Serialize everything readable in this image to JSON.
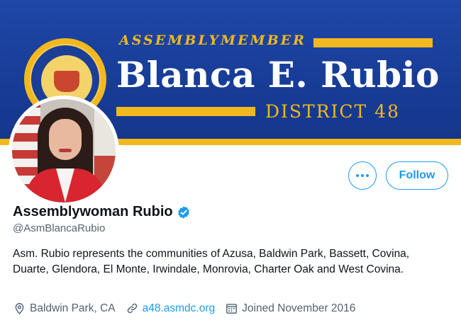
{
  "banner": {
    "kicker": "ASSEMBLYMEMBER",
    "name": "Blanca E. Rubio",
    "district": "DISTRICT 48",
    "colors": {
      "blue": "#1f47a8",
      "gold": "#f2b81e"
    }
  },
  "profile": {
    "display_name": "Assemblywoman Rubio",
    "verified_icon": "verified-badge-icon",
    "handle": "@AsmBlancaRubio",
    "bio": "Asm. Rubio represents the communities of Azusa, Baldwin Park, Bassett, Covina, Duarte, Glendora, El Monte, Irwindale, Monrovia, Charter Oak and West Covina.",
    "location": "Baldwin Park, CA",
    "website": "a48.asmdc.org",
    "joined": "Joined November 2016"
  },
  "actions": {
    "more_icon": "more-icon",
    "follow_label": "Follow"
  },
  "colors": {
    "accent": "#1d9bf0",
    "muted": "#536471",
    "text": "#0f1419"
  }
}
